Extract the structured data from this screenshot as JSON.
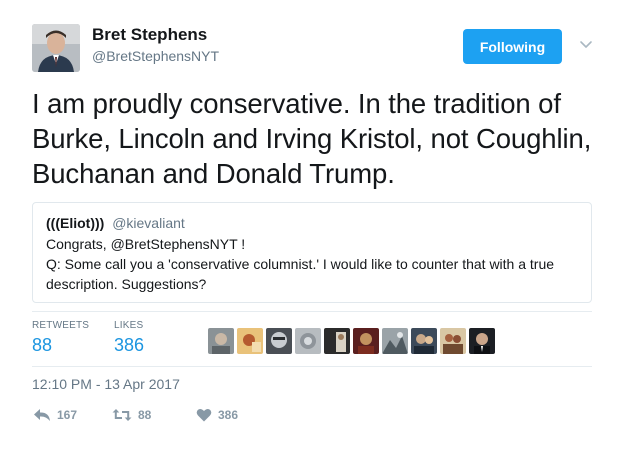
{
  "author": {
    "name": "Bret Stephens",
    "handle": "@BretStephensNYT"
  },
  "follow_button": "Following",
  "tweet": {
    "text": "I am proudly conservative. In the tradition of Burke, Lincoln and Irving Kristol, not Coughlin, Buchanan and Donald Trump."
  },
  "quoted": {
    "name": "(((Eliot)))",
    "handle": "@kievaliant",
    "line1": "Congrats, @BretStephensNYT !",
    "line2": "Q: Some call you a 'conservative columnist.' I would like to counter that with a true description. Suggestions?"
  },
  "stats": {
    "retweets_label": "RETWEETS",
    "retweets": "88",
    "likes_label": "LIKES",
    "likes": "386"
  },
  "timestamp": "12:10 PM - 13 Apr 2017",
  "actions": {
    "replies": "167",
    "retweets": "88",
    "likes": "386"
  },
  "colors": {
    "accent": "#1da1f2",
    "stat_value": "#1b95e0",
    "muted": "#657786",
    "action": "#8899a6"
  }
}
